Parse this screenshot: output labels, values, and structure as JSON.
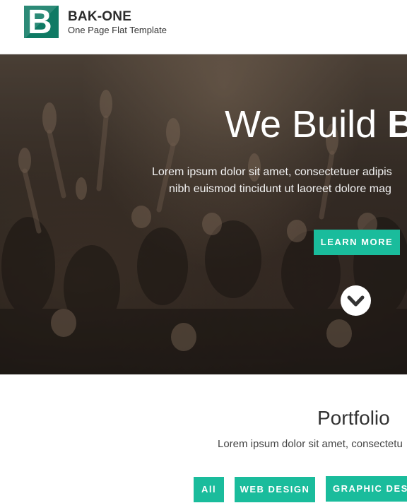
{
  "header": {
    "logo_letter": "B",
    "brand_title": "BAK-ONE",
    "brand_subtitle": "One Page Flat Template"
  },
  "hero": {
    "title_light": "We Build ",
    "title_bold": "B",
    "text_line1": "Lorem ipsum dolor sit amet, consectetuer adipis",
    "text_line2": "nibh euismod tincidunt ut laoreet dolore mag",
    "cta_label": "LEARN MORE",
    "scroll_icon": "chevron-down-icon"
  },
  "portfolio": {
    "title": "Portfolio",
    "text": "Lorem ipsum dolor sit amet, consectetu",
    "filters": [
      "All",
      "WEB DESIGN",
      "GRAPHIC DESIG"
    ]
  },
  "colors": {
    "accent": "#1abc9c",
    "logo_bg": "#0f7a64"
  }
}
